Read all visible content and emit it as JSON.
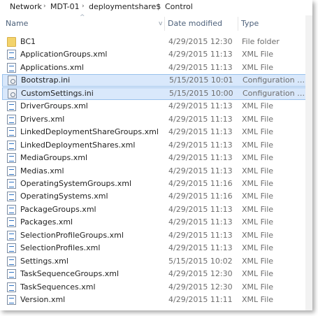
{
  "breadcrumb": {
    "items": [
      "Network",
      "MDT-01",
      "deploymentshare$",
      "Control"
    ],
    "separator": "›"
  },
  "columns": {
    "name": "Name",
    "date_modified": "Date modified",
    "type": "Type"
  },
  "files": [
    {
      "name": "BC1",
      "date": "4/29/2015 12:30",
      "type": "File folder",
      "icon": "folder-icon",
      "selected": false
    },
    {
      "name": "ApplicationGroups.xml",
      "date": "4/29/2015 11:13",
      "type": "XML File",
      "icon": "xml-file-icon",
      "selected": false
    },
    {
      "name": "Applications.xml",
      "date": "4/29/2015 11:13",
      "type": "XML File",
      "icon": "xml-file-icon",
      "selected": false
    },
    {
      "name": "Bootstrap.ini",
      "date": "5/15/2015 10:01",
      "type": "Configuration sett...",
      "icon": "config-file-icon",
      "selected": true
    },
    {
      "name": "CustomSettings.ini",
      "date": "5/15/2015 10:00",
      "type": "Configuration sett...",
      "icon": "config-file-icon",
      "selected": true
    },
    {
      "name": "DriverGroups.xml",
      "date": "4/29/2015 11:13",
      "type": "XML File",
      "icon": "xml-file-icon",
      "selected": false
    },
    {
      "name": "Drivers.xml",
      "date": "4/29/2015 11:13",
      "type": "XML File",
      "icon": "xml-file-icon",
      "selected": false
    },
    {
      "name": "LinkedDeploymentShareGroups.xml",
      "date": "4/29/2015 11:13",
      "type": "XML File",
      "icon": "xml-file-icon",
      "selected": false
    },
    {
      "name": "LinkedDeploymentShares.xml",
      "date": "4/29/2015 11:13",
      "type": "XML File",
      "icon": "xml-file-icon",
      "selected": false
    },
    {
      "name": "MediaGroups.xml",
      "date": "4/29/2015 11:13",
      "type": "XML File",
      "icon": "xml-file-icon",
      "selected": false
    },
    {
      "name": "Medias.xml",
      "date": "4/29/2015 11:13",
      "type": "XML File",
      "icon": "xml-file-icon",
      "selected": false
    },
    {
      "name": "OperatingSystemGroups.xml",
      "date": "4/29/2015 11:16",
      "type": "XML File",
      "icon": "xml-file-icon",
      "selected": false
    },
    {
      "name": "OperatingSystems.xml",
      "date": "4/29/2015 11:16",
      "type": "XML File",
      "icon": "xml-file-icon",
      "selected": false
    },
    {
      "name": "PackageGroups.xml",
      "date": "4/29/2015 11:13",
      "type": "XML File",
      "icon": "xml-file-icon",
      "selected": false
    },
    {
      "name": "Packages.xml",
      "date": "4/29/2015 11:13",
      "type": "XML File",
      "icon": "xml-file-icon",
      "selected": false
    },
    {
      "name": "SelectionProfileGroups.xml",
      "date": "4/29/2015 11:13",
      "type": "XML File",
      "icon": "xml-file-icon",
      "selected": false
    },
    {
      "name": "SelectionProfiles.xml",
      "date": "4/29/2015 11:13",
      "type": "XML File",
      "icon": "xml-file-icon",
      "selected": false
    },
    {
      "name": "Settings.xml",
      "date": "5/15/2015 10:02",
      "type": "XML File",
      "icon": "xml-file-icon",
      "selected": false
    },
    {
      "name": "TaskSequenceGroups.xml",
      "date": "4/29/2015 12:30",
      "type": "XML File",
      "icon": "xml-file-icon",
      "selected": false
    },
    {
      "name": "TaskSequences.xml",
      "date": "4/29/2015 12:30",
      "type": "XML File",
      "icon": "xml-file-icon",
      "selected": false
    },
    {
      "name": "Version.xml",
      "date": "4/29/2015 11:11",
      "type": "XML File",
      "icon": "xml-file-icon",
      "selected": false
    }
  ],
  "colors": {
    "selection_bg": "#d9e8fb",
    "selection_border": "#99c1ec",
    "header_text": "#4c607a",
    "secondary_text": "#6d6d6d"
  }
}
